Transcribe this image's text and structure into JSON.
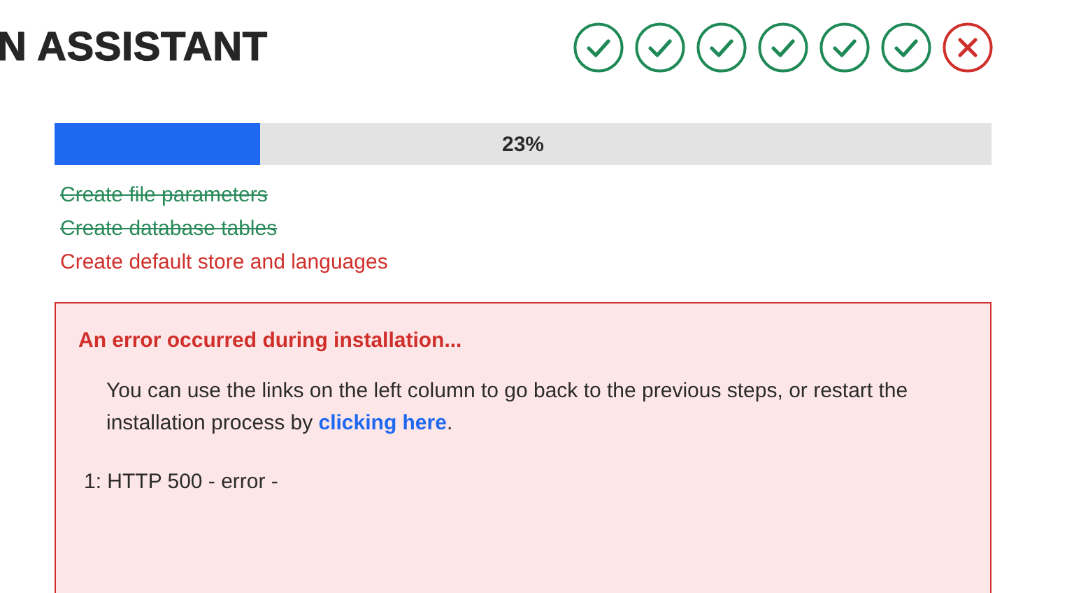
{
  "header": {
    "title": "N ASSISTANT"
  },
  "steps": [
    {
      "kind": "done"
    },
    {
      "kind": "done"
    },
    {
      "kind": "done"
    },
    {
      "kind": "done"
    },
    {
      "kind": "done"
    },
    {
      "kind": "done"
    },
    {
      "kind": "failed"
    }
  ],
  "progress": {
    "level": 0.22,
    "label": "23%"
  },
  "tasks": [
    {
      "label": "Create file parameters",
      "kind": "done"
    },
    {
      "label": "Create database tables",
      "kind": "done"
    },
    {
      "label": "Create default store and languages",
      "kind": "failed"
    }
  ],
  "error": {
    "title": "An error occurred during installation...",
    "message_before": "You can use the links on the left column to go back to the previous steps, or restart the installation process by ",
    "link": "clicking here",
    "message_after": ".",
    "details": [
      "1: HTTP 500 - error -"
    ]
  }
}
